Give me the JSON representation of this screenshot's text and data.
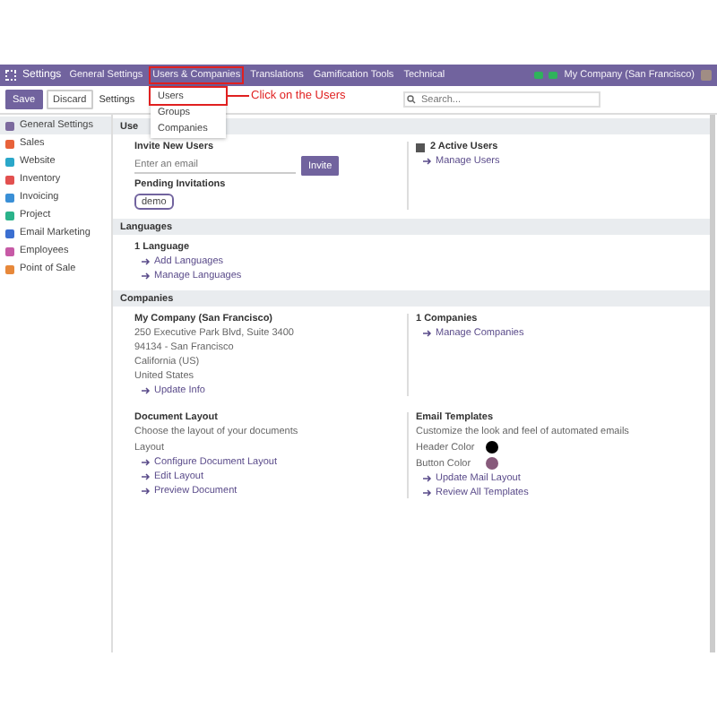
{
  "top_bar": {
    "app": "Settings",
    "menu": [
      {
        "label": "General Settings",
        "selected": false
      },
      {
        "label": "Users & Companies",
        "selected": true
      },
      {
        "label": "Translations",
        "selected": false
      },
      {
        "label": "Gamification Tools",
        "selected": false
      },
      {
        "label": "Technical",
        "selected": false
      }
    ],
    "company": "My Company (San Francisco)"
  },
  "dropdown": {
    "items": [
      {
        "label": "Users",
        "highlighted": true
      },
      {
        "label": "Groups",
        "highlighted": false
      },
      {
        "label": "Companies",
        "highlighted": false
      }
    ]
  },
  "annotation": {
    "text": "Click on the Users"
  },
  "control_bar": {
    "buttons": [
      {
        "label": "Save",
        "kind": "primary"
      },
      {
        "label": "Discard",
        "kind": "secondary"
      }
    ],
    "breadcrumb": "Settings",
    "search": {
      "placeholder": "Search..."
    }
  },
  "sidebar": {
    "items": [
      {
        "label": "General Settings",
        "selected": true,
        "color": "#7c6a9e"
      },
      {
        "label": "Sales",
        "selected": false,
        "color": "#e8623a"
      },
      {
        "label": "Website",
        "selected": false,
        "color": "#2aa7c9"
      },
      {
        "label": "Inventory",
        "selected": false,
        "color": "#e2504f"
      },
      {
        "label": "Invoicing",
        "selected": false,
        "color": "#3a8fd6"
      },
      {
        "label": "Project",
        "selected": false,
        "color": "#2bb38a"
      },
      {
        "label": "Email Marketing",
        "selected": false,
        "color": "#3b6fd1"
      },
      {
        "label": "Employees",
        "selected": false,
        "color": "#c75aa6"
      },
      {
        "label": "Point of Sale",
        "selected": false,
        "color": "#e7883a"
      }
    ]
  },
  "users": {
    "tab": "Use",
    "invite_title": "Invite New Users",
    "email_placeholder": "Enter an email",
    "invite_button": "Invite",
    "pending_title": "Pending Invitations",
    "pending": [
      "demo"
    ],
    "active_users": "2 Active Users",
    "manage_link": "Manage Users"
  },
  "languages": {
    "title": "Languages",
    "count": "1 Language",
    "links": [
      "Add Languages",
      "Manage Languages"
    ]
  },
  "companies": {
    "title": "Companies",
    "name": "My Company (San Francisco)",
    "address": [
      "250 Executive Park Blvd, Suite 3400",
      "94134 - San Francisco",
      "California (US)",
      "United States"
    ],
    "update_link": "Update Info",
    "count": "1 Companies",
    "manage_link": "Manage Companies",
    "document_layout": {
      "title": "Document Layout",
      "hint": "Choose the layout of your documents",
      "label": "Layout",
      "links": [
        "Configure Document Layout",
        "Edit Layout",
        "Preview Document"
      ]
    },
    "email_templates": {
      "title": "Email Templates",
      "hint": "Customize the look and feel of automated emails",
      "colors": [
        {
          "label": "Header Color",
          "color": "#000000"
        },
        {
          "label": "Button Color",
          "color": "#875a7b"
        }
      ],
      "links": [
        "Update Mail Layout",
        "Review All Templates"
      ]
    }
  }
}
